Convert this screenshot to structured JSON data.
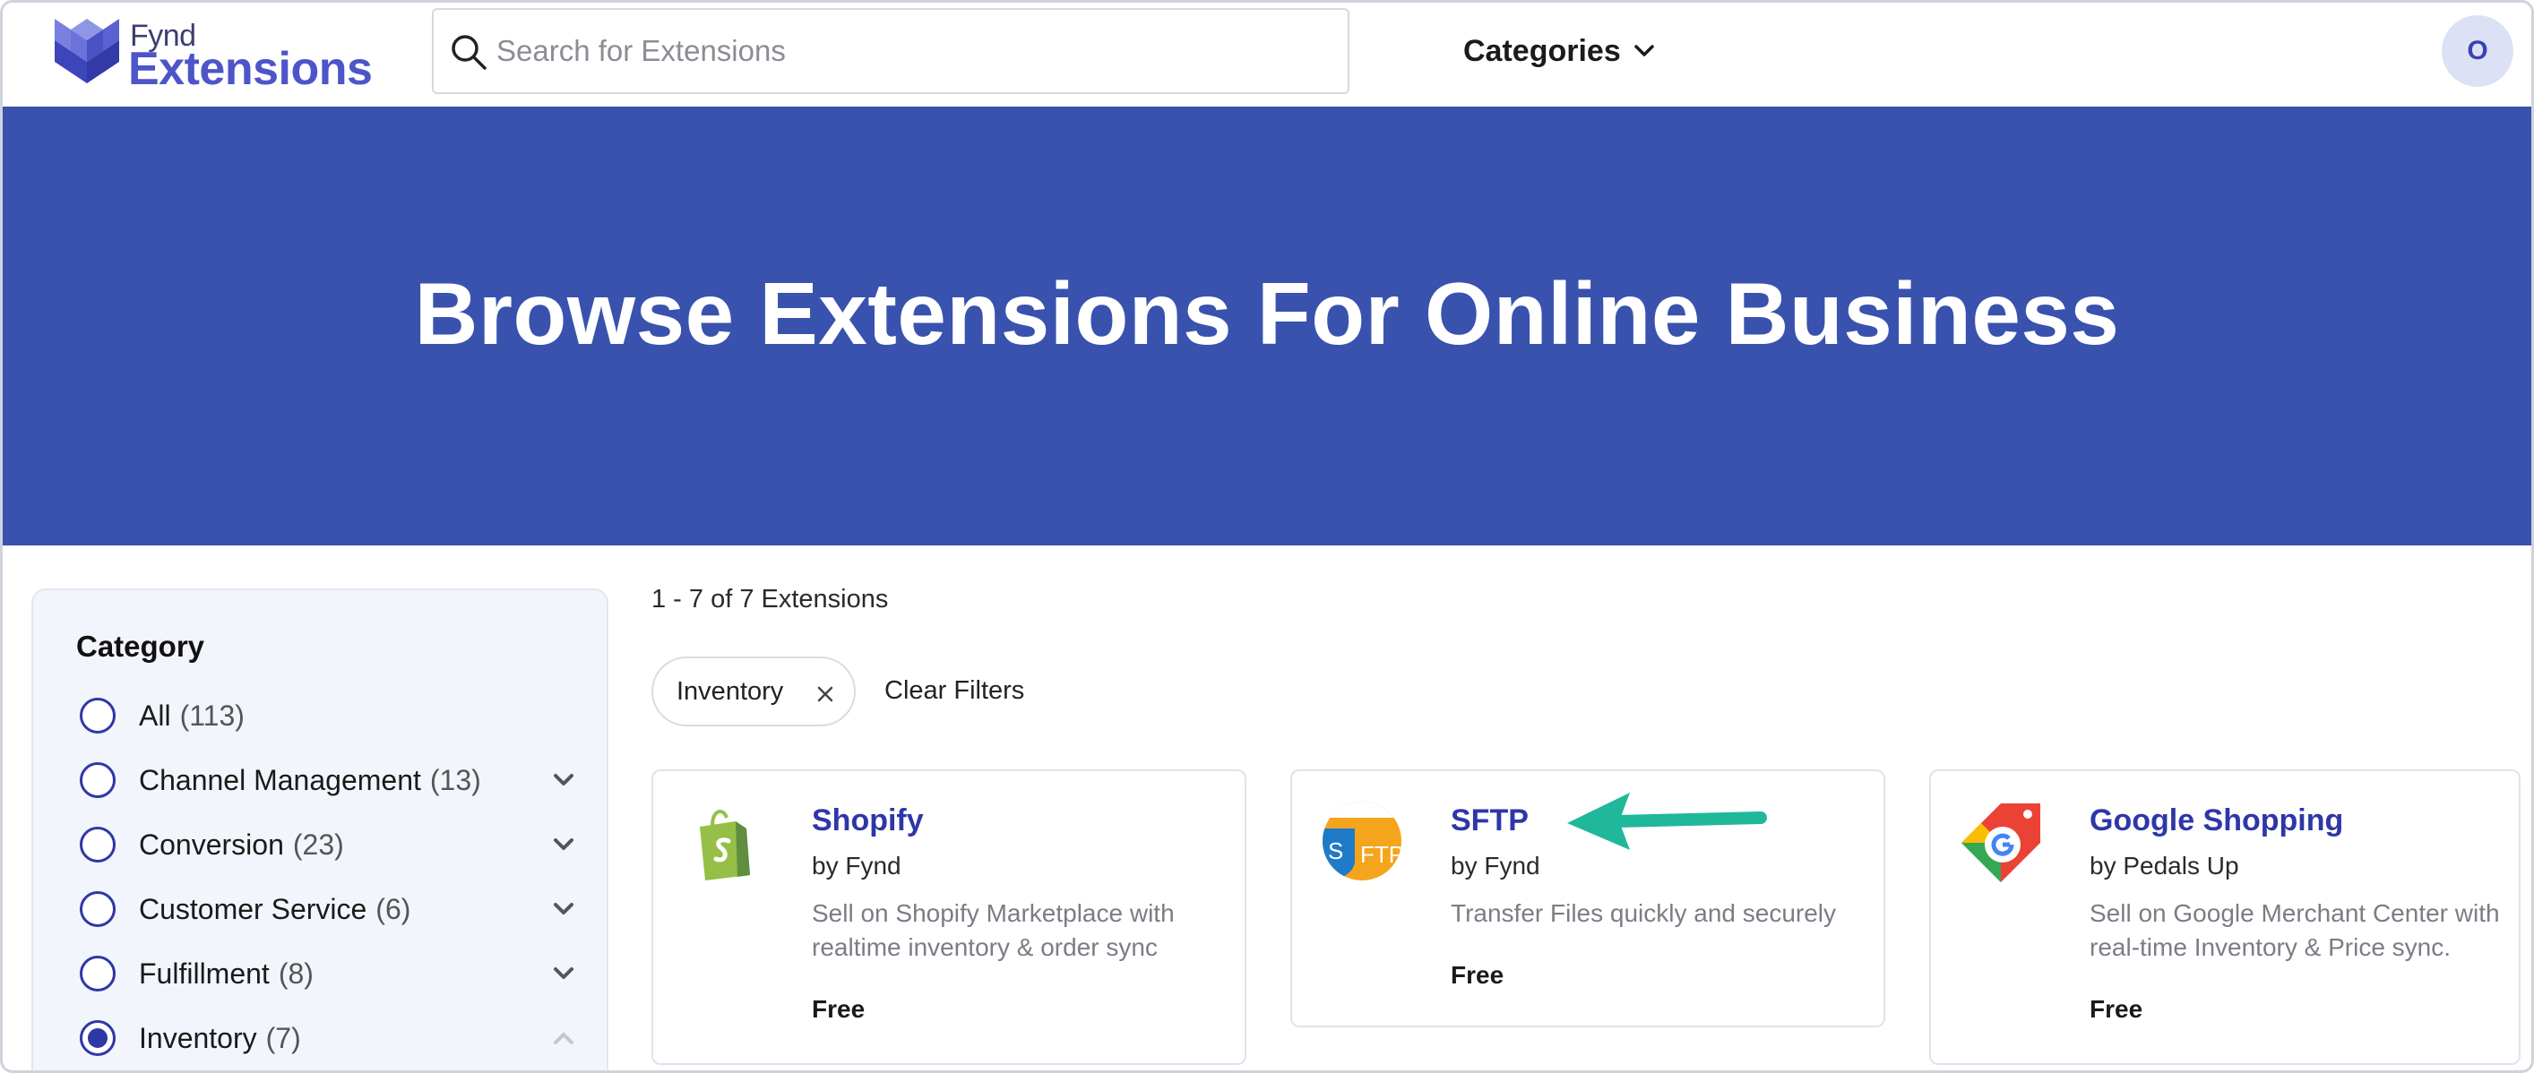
{
  "brand": {
    "small": "Fynd",
    "big": "Extensions"
  },
  "search": {
    "placeholder": "Search for Extensions"
  },
  "nav": {
    "categories_label": "Categories"
  },
  "user": {
    "avatar_initial": "O"
  },
  "hero": {
    "title": "Browse Extensions For Online Business"
  },
  "sidebar": {
    "title": "Category",
    "items": [
      {
        "label": "All",
        "count": "(113)",
        "selected": false,
        "expandable": false
      },
      {
        "label": "Channel Management",
        "count": "(13)",
        "selected": false,
        "expandable": true,
        "expanded": false
      },
      {
        "label": "Conversion",
        "count": "(23)",
        "selected": false,
        "expandable": true,
        "expanded": false
      },
      {
        "label": "Customer Service",
        "count": "(6)",
        "selected": false,
        "expandable": true,
        "expanded": false
      },
      {
        "label": "Fulfillment",
        "count": "(8)",
        "selected": false,
        "expandable": true,
        "expanded": false
      },
      {
        "label": "Inventory",
        "count": "(7)",
        "selected": true,
        "expandable": true,
        "expanded": true
      }
    ]
  },
  "results": {
    "count_text": "1 - 7 of 7 Extensions",
    "active_filter": "Inventory",
    "clear_label": "Clear Filters"
  },
  "cards": [
    {
      "name": "Shopify",
      "by": "by Fynd",
      "description": "Sell on Shopify Marketplace with realtime inventory & order sync",
      "price": "Free",
      "icon": "shopify-bag-icon"
    },
    {
      "name": "SFTP",
      "by": "by Fynd",
      "description": "Transfer Files quickly and securely",
      "price": "Free",
      "icon": "sftp-icon"
    },
    {
      "name": "Google Shopping",
      "by": "by Pedals Up",
      "description": "Sell on Google Merchant Center with real-time Inventory & Price sync.",
      "price": "Free",
      "icon": "google-shopping-icon"
    }
  ],
  "colors": {
    "hero_bg": "#3952ae",
    "accent": "#2e36a8",
    "arrow": "#1fb89a",
    "sidebar_bg": "#f3f5fc"
  }
}
